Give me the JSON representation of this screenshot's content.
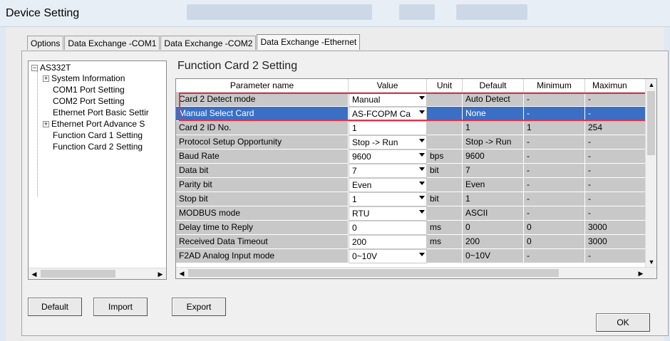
{
  "window": {
    "title": "Device Setting"
  },
  "tabs": [
    {
      "label": "Options"
    },
    {
      "label": "Data Exchange -COM1"
    },
    {
      "label": "Data Exchange -COM2"
    },
    {
      "label": "Data Exchange -Ethernet"
    }
  ],
  "tree": {
    "root": "AS332T",
    "items": [
      {
        "label": "System Information",
        "expandable": true
      },
      {
        "label": "COM1 Port Setting",
        "expandable": false
      },
      {
        "label": "COM2 Port Setting",
        "expandable": false
      },
      {
        "label": "Ethernet Port Basic Settir",
        "expandable": false
      },
      {
        "label": "Ethernet Port Advance S",
        "expandable": true
      },
      {
        "label": "Function Card 1 Setting",
        "expandable": false
      },
      {
        "label": "Function Card 2 Setting",
        "expandable": false
      }
    ]
  },
  "section_title": "Function Card 2 Setting",
  "table": {
    "headers": [
      "Parameter name",
      "Value",
      "Unit",
      "Default",
      "Minimum",
      "Maximun"
    ],
    "rows": [
      {
        "name": "Card 2 Detect mode",
        "value": "Manual",
        "dropdown": true,
        "unit": "",
        "default": "Auto Detect",
        "min": "-",
        "max": "-"
      },
      {
        "name": "Manual Select Card",
        "value": "AS-FCOPM Ca",
        "dropdown": true,
        "unit": "",
        "default": "None",
        "min": "-",
        "max": "-"
      },
      {
        "name": "Card 2 ID No.",
        "value": "1",
        "dropdown": false,
        "unit": "",
        "default": "1",
        "min": "1",
        "max": "254"
      },
      {
        "name": "Protocol Setup Opportunity",
        "value": "Stop -> Run",
        "dropdown": true,
        "unit": "",
        "default": "Stop -> Run",
        "min": "-",
        "max": "-"
      },
      {
        "name": "Baud Rate",
        "value": "9600",
        "dropdown": true,
        "unit": "bps",
        "default": "9600",
        "min": "-",
        "max": "-"
      },
      {
        "name": "Data bit",
        "value": "7",
        "dropdown": true,
        "unit": "bit",
        "default": "7",
        "min": "-",
        "max": "-"
      },
      {
        "name": "Parity bit",
        "value": "Even",
        "dropdown": true,
        "unit": "",
        "default": "Even",
        "min": "-",
        "max": "-"
      },
      {
        "name": "Stop bit",
        "value": "1",
        "dropdown": true,
        "unit": "bit",
        "default": "1",
        "min": "-",
        "max": "-"
      },
      {
        "name": "MODBUS mode",
        "value": "RTU",
        "dropdown": true,
        "unit": "",
        "default": "ASCII",
        "min": "-",
        "max": "-"
      },
      {
        "name": "Delay time to Reply",
        "value": "0",
        "dropdown": false,
        "unit": "ms",
        "default": "0",
        "min": "0",
        "max": "3000"
      },
      {
        "name": "Received Data Timeout",
        "value": "200",
        "dropdown": false,
        "unit": "ms",
        "default": "200",
        "min": "0",
        "max": "3000"
      },
      {
        "name": "F2AD Analog Input mode",
        "value": "0~10V",
        "dropdown": true,
        "unit": "",
        "default": "0~10V",
        "min": "-",
        "max": "-"
      }
    ]
  },
  "buttons": {
    "default": "Default",
    "import": "Import",
    "export": "Export",
    "ok": "OK"
  },
  "colors": {
    "selection": "#3a6fc4",
    "highlight_box": "#e0324a",
    "readonly_cell": "#c8c8c8"
  }
}
